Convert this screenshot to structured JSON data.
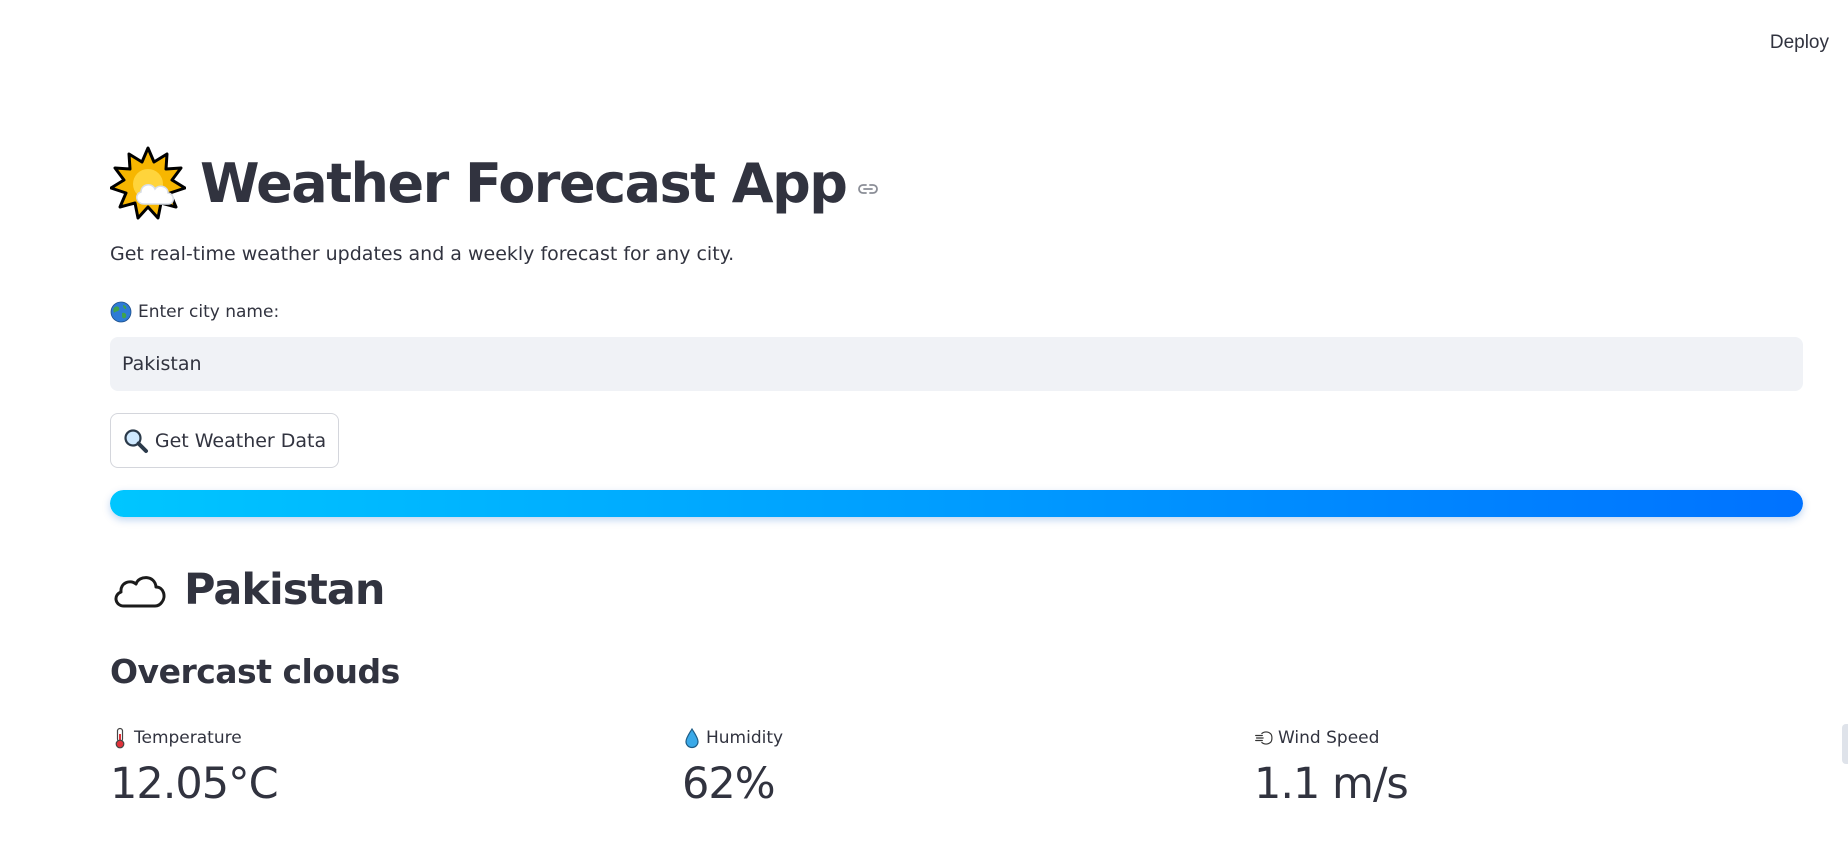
{
  "header": {
    "deploy_label": "Deploy"
  },
  "app": {
    "title": "Weather Forecast App",
    "title_icon": "sun-behind-cloud-icon",
    "subtitle": "Get real-time weather updates and a weekly forecast for any city."
  },
  "search": {
    "label": "Enter city name:",
    "label_icon": "globe-icon",
    "value": "Pakistan",
    "button_label": "Get Weather Data",
    "button_icon": "magnifier-icon"
  },
  "progress": {
    "percent": 100,
    "colors": [
      "#00c6ff",
      "#0072ff"
    ]
  },
  "result": {
    "city": "Pakistan",
    "city_icon": "cloud-icon",
    "condition": "Overcast clouds",
    "metrics": [
      {
        "icon": "thermometer-icon",
        "label": "Temperature",
        "value": "12.05°C"
      },
      {
        "icon": "droplet-icon",
        "label": "Humidity",
        "value": "62%"
      },
      {
        "icon": "wind-icon",
        "label": "Wind Speed",
        "value": "1.1 m/s"
      }
    ]
  },
  "colors": {
    "text": "#31333f",
    "input_bg": "#f0f2f6",
    "accent_start": "#00c6ff",
    "accent_end": "#0072ff"
  }
}
